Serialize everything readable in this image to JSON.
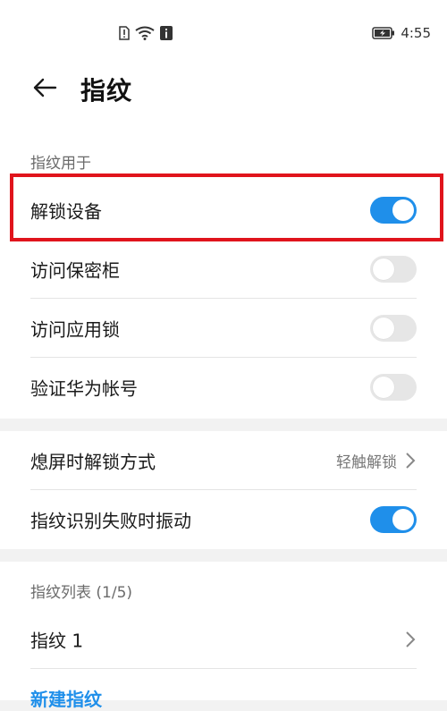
{
  "status_bar": {
    "time": "4:55",
    "icons": [
      "sim-alert-icon",
      "wifi-icon",
      "info-icon",
      "battery-charging-icon"
    ]
  },
  "header": {
    "title": "指纹",
    "back_icon": "arrow-left-icon"
  },
  "section_usage": {
    "label": "指纹用于",
    "items": [
      {
        "label": "解锁设备",
        "toggle": "on"
      },
      {
        "label": "访问保密柜",
        "toggle": "off"
      },
      {
        "label": "访问应用锁",
        "toggle": "off"
      },
      {
        "label": "验证华为帐号",
        "toggle": "off"
      }
    ]
  },
  "section_settings": {
    "items": [
      {
        "label": "熄屏时解锁方式",
        "value": "轻触解锁"
      },
      {
        "label": "指纹识别失败时振动",
        "toggle": "on"
      }
    ]
  },
  "section_list": {
    "label": "指纹列表 (1/5)",
    "items": [
      {
        "label": "指纹 1"
      }
    ],
    "new_link": "新建指纹"
  },
  "colors": {
    "accent": "#1f8fea",
    "highlight": "#e0141c",
    "toggle_off": "#e6e6e6"
  }
}
